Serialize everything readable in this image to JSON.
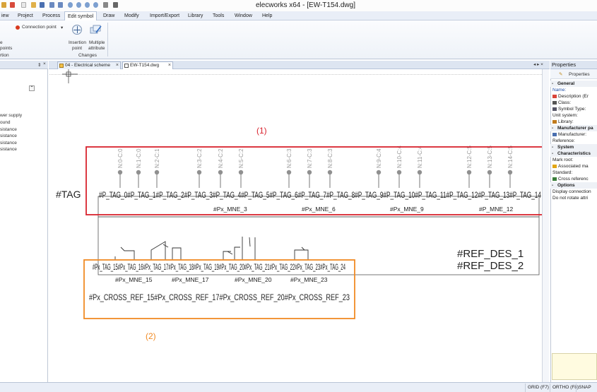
{
  "window": {
    "title": "elecworks x64 - [EW-T154.dwg]"
  },
  "menu": {
    "items": [
      "iew",
      "Project",
      "Process",
      "Edit symbol",
      "Draw",
      "Modify",
      "Import/Export",
      "Library",
      "Tools",
      "Window",
      "Help"
    ],
    "active_index": 3
  },
  "ribbon": {
    "connection_point": "Connection point",
    "left_fragment_1": "e",
    "left_fragment_2": "points",
    "left_fragment_3": "rtion",
    "insertion_label_1": "Insertion",
    "insertion_label_2": "point",
    "multiple_label_1": "Multiple",
    "multiple_label_2": "attribute",
    "group_changes": "Changes"
  },
  "left_panel": {
    "pin_icon": "pin-icon",
    "close_icon": "close-icon",
    "items": [
      "wer supply",
      "ound",
      "sistance",
      "sistance",
      "sistance",
      "sistance"
    ]
  },
  "tabs": [
    {
      "label": "04 - Electrical scheme",
      "close": "×"
    },
    {
      "label": "EW-T154.dwg",
      "close": "×",
      "active": true
    }
  ],
  "tabs_nav": "◂ ▸ ×",
  "properties": {
    "title": "Properties",
    "toolbar_label": "Properties",
    "rows": [
      {
        "text": "General",
        "section": true
      },
      {
        "text": "Name:",
        "color": "#1f4fa8"
      },
      {
        "text": "Description (Er",
        "icon": "flag-icon"
      },
      {
        "text": "Class:",
        "icon": "class-icon"
      },
      {
        "text": "Symbol Type:",
        "icon": "symbol-icon"
      },
      {
        "text": "Unit system:"
      },
      {
        "text": "Library:",
        "icon": "library-icon"
      },
      {
        "text": "Manufacturer pa",
        "section": true
      },
      {
        "text": "Manufacturer:",
        "icon": "wrench-icon"
      },
      {
        "text": "Reference:"
      },
      {
        "text": "System",
        "section": true
      },
      {
        "text": "Characteristics",
        "section": true
      },
      {
        "text": "Mark root:"
      },
      {
        "text": "Associated ma",
        "icon": "star-icon"
      },
      {
        "text": "Standard:"
      },
      {
        "text": "Cross referenc",
        "icon": "cross-ref-icon"
      },
      {
        "text": "Options",
        "section": true
      },
      {
        "text": "Display connection"
      },
      {
        "text": "Do not rotate attri"
      }
    ]
  },
  "status": {
    "grid": "GRID (F7)",
    "ortho": "ORTHO (F8)",
    "snap": "SNAP (F9"
  },
  "drawing": {
    "label_1": "(1)",
    "label_2": "(2)",
    "tag_outside": "#TAG",
    "pin_labels": [
      "N:0-C:0",
      "N:1-C:0",
      "N:2-C:1",
      "N:3-C:2",
      "N:4-C:2",
      "N:5-C:2",
      "N:6-C:3",
      "N:7-C:3",
      "N:8-C:3",
      "N:9-C:4",
      "N:10-C:4",
      "N:11-C:4",
      "N:12-C:5",
      "N:13-C:5",
      "N:14-C:5"
    ],
    "tags_row": "#P_TAG_0#P_TAG_1#P_TAG_2#P_TAG_3#P_TAG_4#P_TAG_5#P_TAG_6#P_TAG_7#P_TAG_8#P_TAG_9#P_TAG_10#P_TAG_11#P_TAG_12#P_TAG_13#P_TAG_14",
    "mne_top": [
      "#Px_MNE_3",
      "#Px_MNE_6",
      "#Px_MNE_9",
      "#P_MNE_12"
    ],
    "ref_des_1": "#REF_DES_1",
    "ref_des_2": "#REF_DES_2",
    "px_tags_row": "#Px_TAG_15#Px_TAG_16#Px_TAG_17#Px_TAG_18#Px_TAG_19#Px_TAG_20#Px_TAG_21#Px_TAG_22#Px_TAG_23#Px_TAG_24",
    "mne_bottom": [
      "#Px_MNE_15",
      "#Px_MNE_17",
      "#Px_MNE_20",
      "#Px_MNE_23"
    ],
    "cross_refs": [
      "#Px_CROSS_REF_15",
      "#Px_CROSS_REF_17",
      "#Px_CROSS_REF_20",
      "#Px_CROSS_REF_23"
    ],
    "colors": {
      "frame_1": "#d9232e",
      "frame_2": "#f08a24",
      "label_1": "#d9232e",
      "label_2": "#f08a24",
      "pin": "#909090"
    }
  }
}
